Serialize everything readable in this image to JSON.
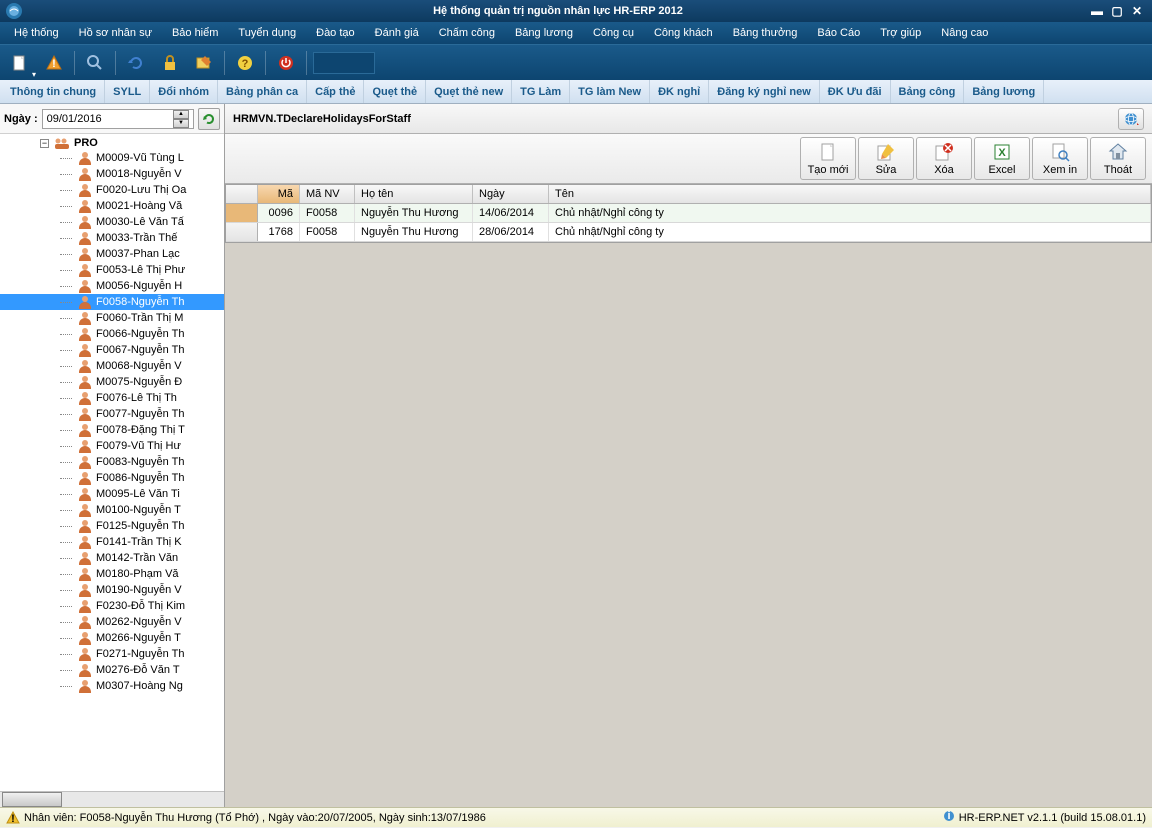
{
  "window": {
    "title": "Hệ thống quản trị nguồn nhân lực HR-ERP 2012"
  },
  "menu": [
    "Hệ thống",
    "Hồ sơ nhân sự",
    "Bảo hiểm",
    "Tuyển dụng",
    "Đào tạo",
    "Đánh giá",
    "Chấm công",
    "Bảng lương",
    "Công cụ",
    "Công khách",
    "Bảng thưởng",
    "Báo Cáo",
    "Trợ giúp",
    "Nâng cao"
  ],
  "tabs": [
    "Thông tin chung",
    "SYLL",
    "Đổi nhóm",
    "Bảng phân ca",
    "Cấp thẻ",
    "Quẹt thẻ",
    "Quẹt thẻ new",
    "TG Làm",
    "TG làm New",
    "ĐK nghỉ",
    "Đăng ký nghỉ new",
    "ĐK Ưu đãi",
    "Bảng công",
    "Bảng lương"
  ],
  "datebar": {
    "label": "Ngày :",
    "value": "09/01/2016"
  },
  "tree": {
    "root": "PRO",
    "items": [
      "M0009-Vũ Tùng L",
      "M0018-Nguyễn V",
      "F0020-Lưu Thị Oa",
      "M0021-Hoàng Vă",
      "M0030-Lê Văn Tấ",
      "M0033-Trần Thế",
      "M0037-Phan Lạc",
      "F0053-Lê Thị Phư",
      "M0056-Nguyễn H",
      "F0058-Nguyễn Th",
      "F0060-Trần Thị M",
      "F0066-Nguyễn Th",
      "F0067-Nguyễn Th",
      "M0068-Nguyễn V",
      "M0075-Nguyễn Đ",
      "F0076-Lê Thị Th",
      "F0077-Nguyễn Th",
      "F0078-Đặng Thị T",
      "F0079-Vũ Thị Hư",
      "F0083-Nguyễn Th",
      "F0086-Nguyễn Th",
      "M0095-Lê Văn Ti",
      "M0100-Nguyễn T",
      "F0125-Nguyễn Th",
      "F0141-Trần Thị K",
      "M0142-Trần Văn",
      "M0180-Phạm Vă",
      "M0190-Nguyễn V",
      "F0230-Đỗ Thị Kim",
      "M0262-Nguyễn V",
      "M0266-Nguyễn T",
      "F0271-Nguyễn Th",
      "M0276-Đỗ Văn T",
      "M0307-Hoàng Ng"
    ],
    "selected_index": 9
  },
  "form": {
    "title": "HRMVN.TDeclareHolidaysForStaff"
  },
  "actions": {
    "new": "Tạo mới",
    "edit": "Sửa",
    "delete": "Xóa",
    "excel": "Excel",
    "preview": "Xem in",
    "exit": "Thoát"
  },
  "grid": {
    "columns": {
      "ma": "Mã",
      "manv": "Mã NV",
      "hoten": "Họ tên",
      "ngay": "Ngày",
      "ten": "Tên"
    },
    "rows": [
      {
        "ma": "0096",
        "manv": "F0058",
        "hoten": "Nguyễn Thu Hương",
        "ngay": "14/06/2014",
        "ten": "Chủ nhật/Nghỉ công ty"
      },
      {
        "ma": "1768",
        "manv": "F0058",
        "hoten": "Nguyễn Thu Hương",
        "ngay": "28/06/2014",
        "ten": "Chủ nhật/Nghỉ công ty"
      }
    ],
    "selected_row": 0
  },
  "status": {
    "text": "Nhân viên: F0058-Nguyễn Thu Hương (Tổ Phớ) , Ngày vào:20/07/2005, Ngày sinh:13/07/1986",
    "right": "HR-ERP.NET v2.1.1 (build 15.08.01.1)"
  }
}
